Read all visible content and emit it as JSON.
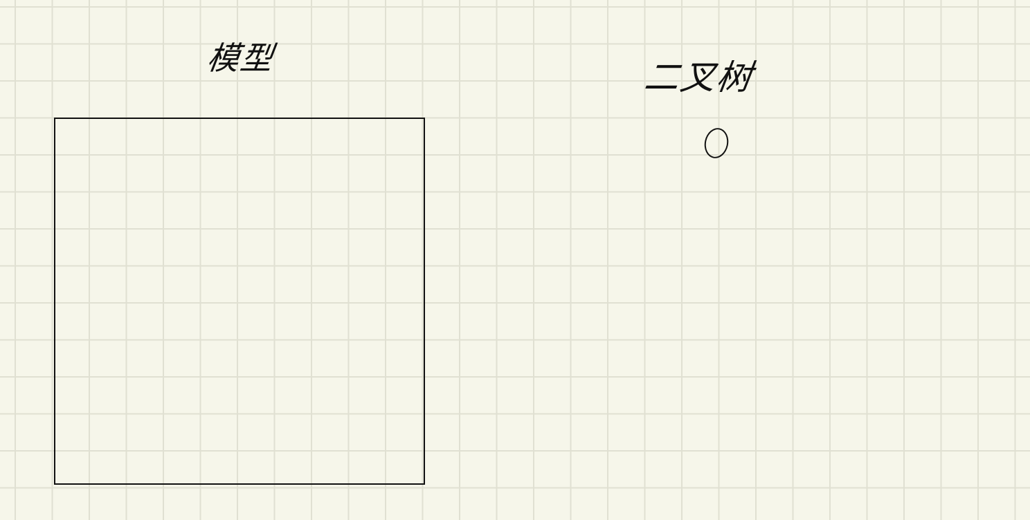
{
  "note": {
    "left_heading": "模型",
    "right_heading": "二叉树"
  },
  "colors": {
    "paper": "#f6f6ea",
    "grid": "#e0e0d2",
    "ink": "#111111"
  }
}
